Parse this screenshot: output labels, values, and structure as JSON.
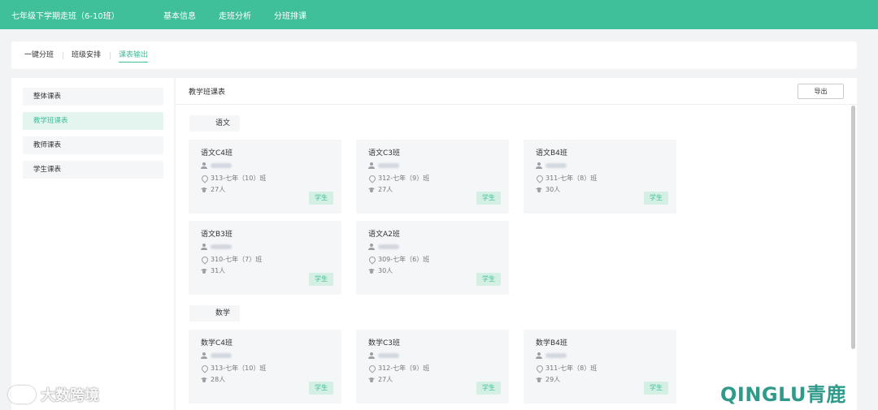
{
  "header": {
    "title": "七年级下学期走班（6-10班）",
    "nav": [
      "基本信息",
      "走班分析",
      "分班排课"
    ]
  },
  "subtabs": [
    {
      "label": "一键分班",
      "active": false
    },
    {
      "label": "班级安排",
      "active": false
    },
    {
      "label": "课表输出",
      "active": true
    }
  ],
  "sidebar": {
    "items": [
      {
        "label": "整体课表",
        "active": false
      },
      {
        "label": "教学班课表",
        "active": true
      },
      {
        "label": "教师课表",
        "active": false
      },
      {
        "label": "学生课表",
        "active": false
      }
    ]
  },
  "main": {
    "title": "教学班课表",
    "export_label": "导出",
    "subjects": [
      {
        "name": "语文",
        "classes": [
          {
            "name": "语文C4班",
            "room": "313-七年（10）班",
            "count": "27人",
            "badge": "学生"
          },
          {
            "name": "语文C3班",
            "room": "312-七年（9）班",
            "count": "27人",
            "badge": "学生"
          },
          {
            "name": "语文B4班",
            "room": "311-七年（8）班",
            "count": "30人",
            "badge": "学生"
          },
          {
            "name": "语文B3班",
            "room": "310-七年（7）班",
            "count": "31人",
            "badge": "学生"
          },
          {
            "name": "语文A2班",
            "room": "309-七年（6）班",
            "count": "30人",
            "badge": "学生"
          }
        ]
      },
      {
        "name": "数学",
        "classes": [
          {
            "name": "数学C4班",
            "room": "313-七年（10）班",
            "count": "28人",
            "badge": "学生"
          },
          {
            "name": "数学C3班",
            "room": "312-七年（9）班",
            "count": "27人",
            "badge": "学生"
          },
          {
            "name": "数学B4班",
            "room": "311-七年（8）班",
            "count": "29人",
            "badge": "学生"
          }
        ]
      }
    ]
  },
  "watermarks": {
    "left": "大数跨境",
    "right": "QINGLU青鹿"
  },
  "colors": {
    "accent": "#3fbf9a",
    "badge_bg": "#d4f0e5"
  }
}
